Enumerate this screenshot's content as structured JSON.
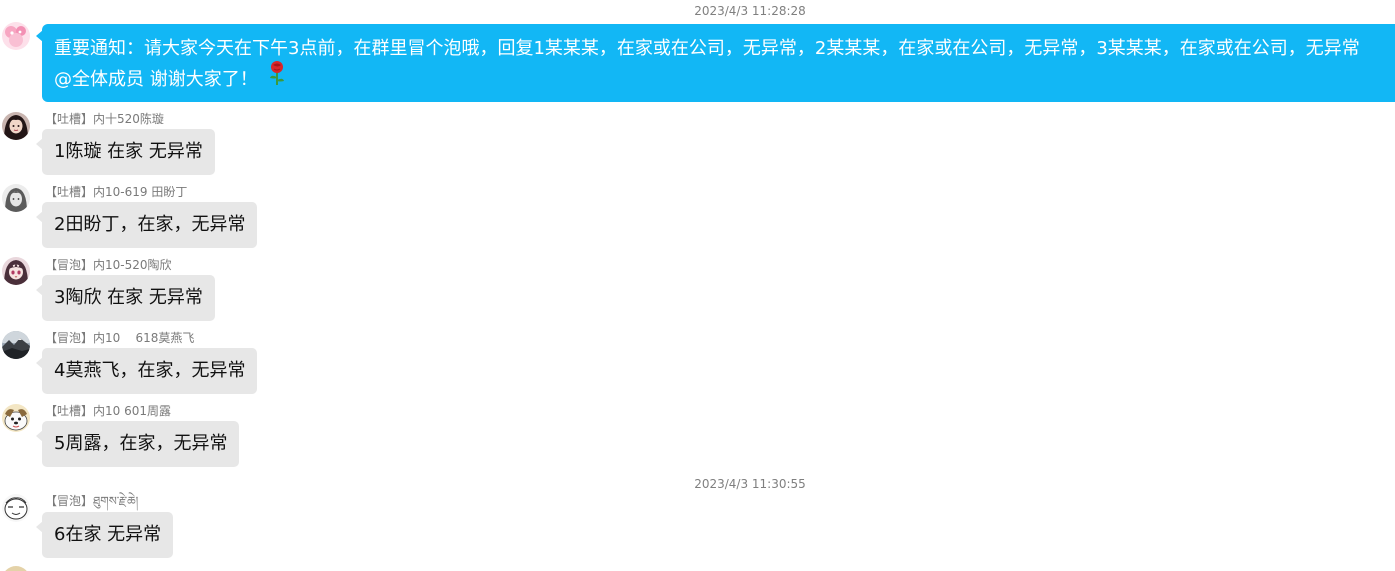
{
  "colors": {
    "notice_bubble": "#12b7f5",
    "message_bubble": "#e7e7e7",
    "timestamp_text": "#7f7f7f",
    "sender_text": "#7a7a7a"
  },
  "timestamps": [
    "2023/4/3 11:28:28",
    "2023/4/3 11:30:55"
  ],
  "notice": {
    "line1": "重要通知：请大家今天在下午3点前，在群里冒个泡哦，回复1某某某，在家或在公司，无异常，2某某某，在家或在公司，无异常，3某某某，在家或在公司，无异常",
    "line2": "@全体成员 谢谢大家了！",
    "emoji": "rose-icon"
  },
  "messages": [
    {
      "sender": "【吐槽】内十520陈璇",
      "text": "1陈璇 在家 无异常",
      "avatar": "avatar-girl-dark-hair"
    },
    {
      "sender": "【吐槽】内10-619 田盼丁",
      "text": "2田盼丁，在家，无异常",
      "avatar": "avatar-girl-grey"
    },
    {
      "sender": "【冒泡】内10-520陶欣",
      "text": "3陶欣 在家 无异常",
      "avatar": "avatar-anime-girl"
    },
    {
      "sender": "【冒泡】内10    618莫燕飞",
      "text": "4莫燕飞，在家，无异常",
      "avatar": "avatar-landscape"
    },
    {
      "sender": "【吐槽】内10 601周露",
      "text": "5周露，在家，无异常",
      "avatar": "avatar-cartoon-dog"
    },
    {
      "sender": "【冒泡】ཐུགས་རྗེ་ཆེ།",
      "text": "6在家 无异常",
      "avatar": "avatar-sketch-face"
    }
  ]
}
